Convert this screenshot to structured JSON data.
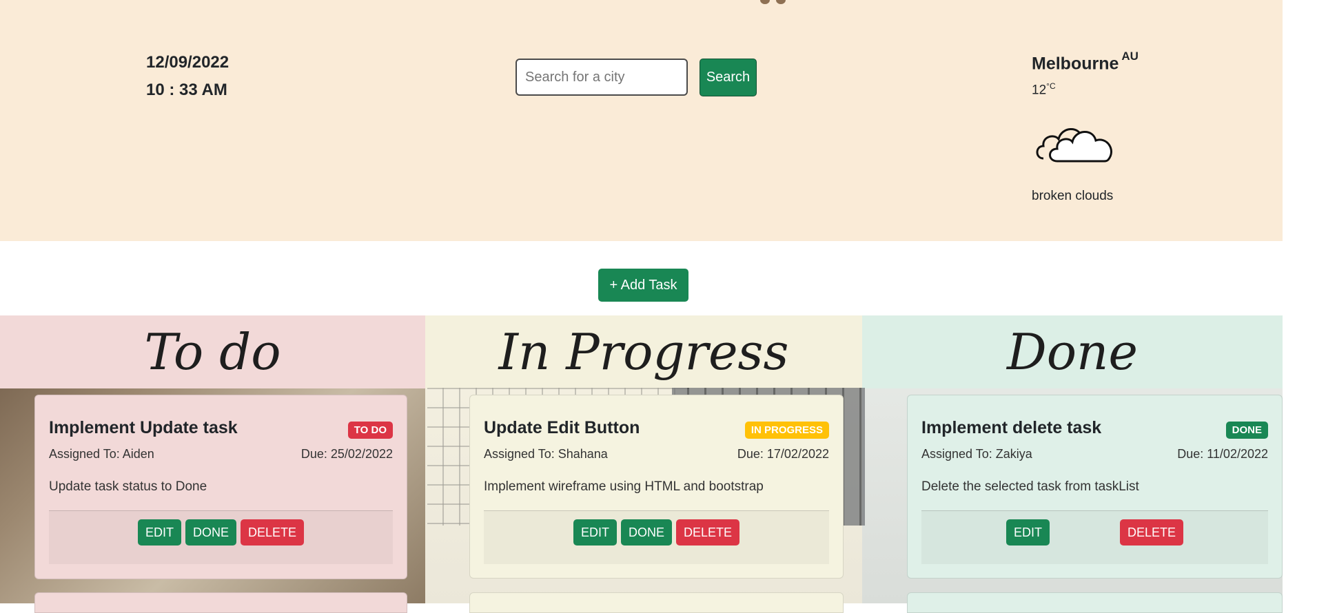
{
  "header": {
    "date": "12/09/2022",
    "time": "10 : 33 AM",
    "search": {
      "placeholder": "Search for a city",
      "button_label": "Search"
    },
    "weather": {
      "city": "Melbourne",
      "country": "AU",
      "temperature": "12",
      "unit": "°C",
      "icon": "cloud-icon",
      "description": "broken clouds"
    }
  },
  "toolbar": {
    "add_task_label": "+ Add Task"
  },
  "columns": [
    {
      "title": "To do",
      "cards": [
        {
          "title": "Implement Update task",
          "status": "TO DO",
          "assigned": "Assigned To: Aiden",
          "due": "Due: 25/02/2022",
          "description": "Update task status to Done",
          "edit_label": "EDIT",
          "done_label": "DONE",
          "delete_label": "DELETE"
        }
      ]
    },
    {
      "title": "In Progress",
      "cards": [
        {
          "title": "Update Edit Button",
          "status": "IN PROGRESS",
          "assigned": "Assigned To: Shahana",
          "due": "Due: 17/02/2022",
          "description": "Implement wireframe using HTML and bootstrap",
          "edit_label": "EDIT",
          "done_label": "DONE",
          "delete_label": "DELETE"
        }
      ]
    },
    {
      "title": "Done",
      "cards": [
        {
          "title": "Implement delete task",
          "status": "DONE",
          "assigned": "Assigned To: Zakiya",
          "due": "Due: 11/02/2022",
          "description": "Delete the selected task from taskList",
          "edit_label": "EDIT",
          "delete_label": "DELETE"
        }
      ]
    }
  ],
  "colors": {
    "header_bg": "#faebd7",
    "primary_green": "#198754",
    "danger_red": "#dc3545",
    "warning_yellow": "#ffc107",
    "todo_bg": "#f2d9d8",
    "progress_bg": "#f5f3e0",
    "done_bg": "#dff0e8"
  }
}
